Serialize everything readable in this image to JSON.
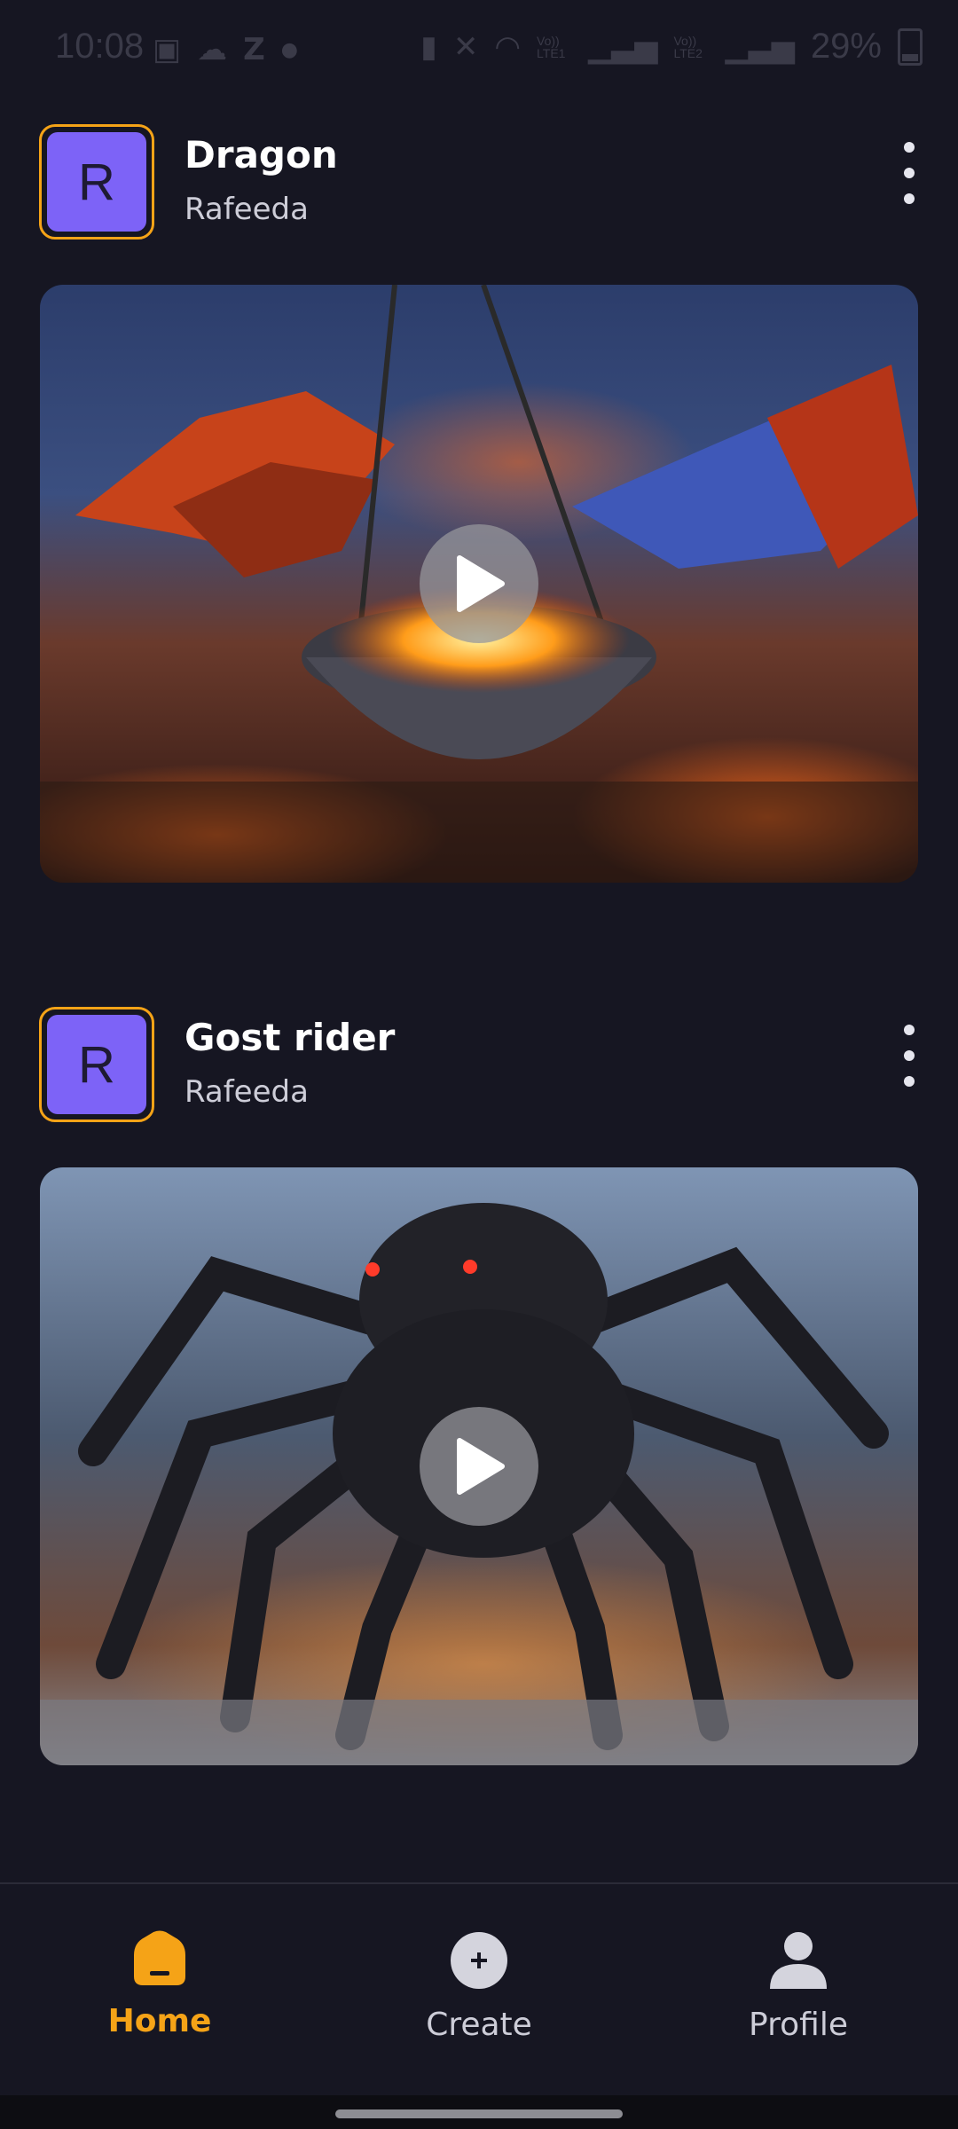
{
  "status_bar": {
    "time": "10:08",
    "battery": "29%",
    "network_labels": [
      "Vo)) LTE1",
      "Vo)) LTE2"
    ]
  },
  "posts": [
    {
      "avatar_letter": "R",
      "title": "Dragon",
      "author": "Rafeeda",
      "thumbnail": "dragons-over-fiery-cauldron"
    },
    {
      "avatar_letter": "R",
      "title": "Gost rider",
      "author": "Rafeeda",
      "thumbnail": "giant-dark-spider"
    }
  ],
  "bottom_nav": {
    "items": [
      {
        "label": "Home",
        "icon": "home-icon",
        "active": true
      },
      {
        "label": "Create",
        "icon": "plus-circle-icon",
        "active": false
      },
      {
        "label": "Profile",
        "icon": "user-icon",
        "active": false
      }
    ]
  },
  "colors": {
    "background": "#161622",
    "accent": "#f5a317",
    "avatar": "#7d63f7"
  }
}
